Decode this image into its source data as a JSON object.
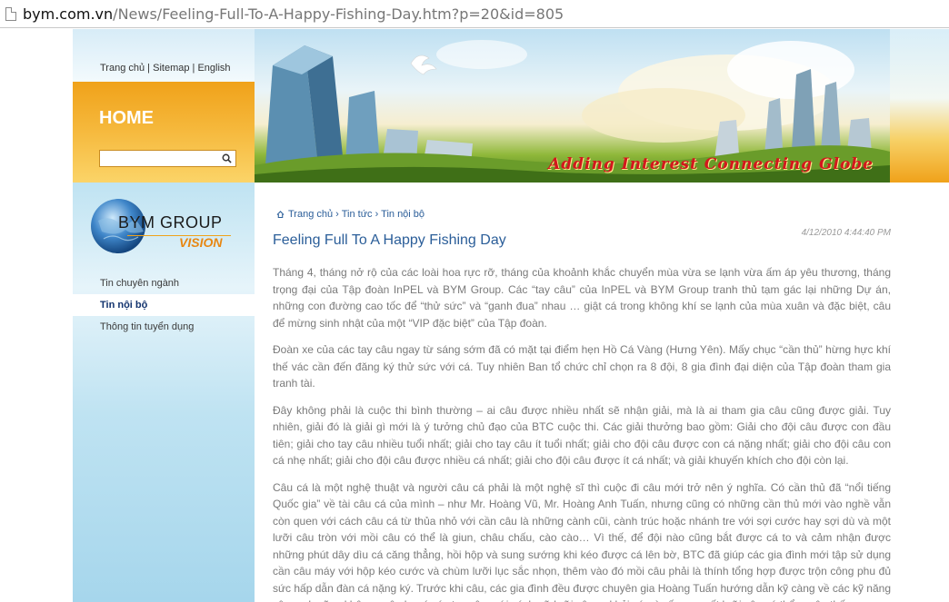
{
  "browser": {
    "url_host": "bym.com.vn",
    "url_path": "/News/Feeling-Full-To-A-Happy-Fishing-Day.htm?p=20&id=805"
  },
  "header": {
    "top_links": [
      "Trang chủ",
      "Sitemap",
      "English"
    ],
    "home_label": "HOME",
    "search_value": "",
    "slogan": "Adding Interest  Connecting Globe"
  },
  "sidebar": {
    "logo_line1": "BYM GROUP",
    "logo_line2": "VISION",
    "items": [
      {
        "label": "Tin chuyên ngành"
      },
      {
        "label": "Tin nội bộ"
      },
      {
        "label": "Thông tin tuyển dụng"
      }
    ]
  },
  "article": {
    "breadcrumb": [
      "Trang chủ",
      "Tin tức",
      "Tin nội bộ"
    ],
    "date": "4/12/2010 4:44:40 PM",
    "title": "Feeling Full To A Happy Fishing Day",
    "paragraphs": [
      "Tháng 4, tháng nở rộ của các loài hoa rực rỡ, tháng của khoảnh khắc chuyển mùa vừa se lạnh vừa ấm áp yêu thương, tháng trọng đại của Tập đoàn InPEL và BYM Group. Các “tay câu” của InPEL và BYM Group tranh thủ tạm gác lại những Dự án, những con đường cao tốc để “thử sức” và “ganh đua” nhau … giật cá trong không khí se lạnh của mùa xuân và đặc biệt, câu để mừng sinh nhật của một “VIP đặc biệt” của Tập đoàn.",
      "Đoàn xe của các tay câu ngay từ sáng sớm đã có mặt tại điểm hẹn Hồ Cá Vàng (Hưng Yên). Mấy chục “cần thủ” hừng hực khí thế vác cần đến đăng ký thử sức với cá. Tuy nhiên Ban tổ chức chỉ chọn ra 8 đội, 8 gia đình đại diện của Tập đoàn tham gia tranh tài.",
      "Đây không phải là cuộc thi bình thường – ai câu được nhiều nhất sẽ nhận giải, mà là ai tham gia câu cũng được giải. Tuy nhiên, giải đó là giải gì mới là ý tưởng chủ đạo của BTC  cuộc thi. Các giải thưởng bao gồm:  Giải cho đội câu được con đầu tiên; giải cho tay câu nhiều tuổi nhất; giải cho tay câu ít tuổi nhất; giải cho đội câu được con cá nặng nhất; giải cho đội câu con cá nhẹ nhất; giải cho đội câu được nhiều cá nhất; giải cho đội câu được ít cá nhất; và giải khuyến khích cho đội còn lại.",
      "Câu cá là một nghệ thuật và người câu cá phải là một nghệ sĩ thì cuộc đi câu mới trở nên ý nghĩa. Có cần thủ đã “nổi tiếng Quốc gia” về tài câu cá của mình – như Mr. Hoàng Vũ, Mr. Hoàng Anh Tuấn, nhưng cũng có những cần thủ mới vào nghề vẫn còn quen với cách câu cá từ thủa nhỏ với cần câu là những cành cũi, cành trúc hoặc nhánh tre với sợi cước hay sợi dù và một lưỡi câu tròn với mồi câu có thể là giun, châu chấu, cào cào… Vì thế, để đội nào cũng bắt được cá to và cảm nhận được những phút dây dìu cá căng thẳng, hồi hộp và sung sướng khi kéo được cá lên bờ, BTC đã giúp các gia đình mới tập sử dụng cần câu máy với hộp kéo cước và chùm lưỡi lục sắc nhọn, thêm vào đó mồi câu phải là thính tổng hợp được trộn công phu đủ sức hấp dẫn đàn cá nặng ký. Trước khi câu, các gia đình đều được chuyên gia Hoàng Tuấn hướng dẫn kỹ càng về các kỹ năng câu, anh cũng không quên lưu ý các tay câu mới cách gỡ lưỡi câu ra khỏi cá, vì nếu sơ suất lưỡi câu có thể xuyên thấu"
    ]
  }
}
